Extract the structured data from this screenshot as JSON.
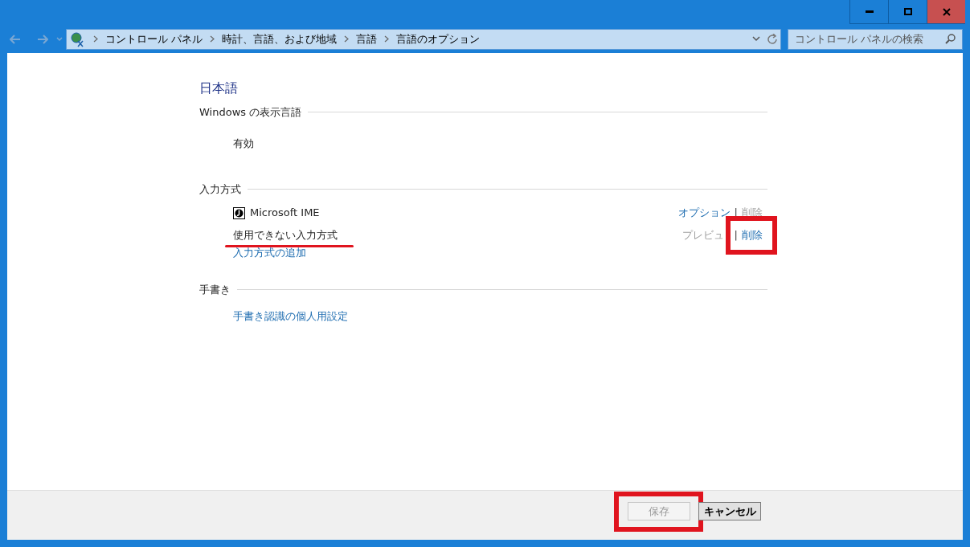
{
  "address_bar": {
    "breadcrumbs": [
      "コントロール パネル",
      "時計、言語、および地域",
      "言語",
      "言語のオプション"
    ]
  },
  "search": {
    "placeholder": "コントロール パネルの検索"
  },
  "language_title": "日本語",
  "sections": [
    {
      "heading": "Windows の表示言語",
      "kind": "status",
      "value": "有効"
    },
    {
      "heading": "入力方式",
      "kind": "methods",
      "methods": [
        {
          "name": "Microsoft IME",
          "icon": true,
          "underlined": false,
          "separator": "|",
          "actions": [
            {
              "label": "オプション",
              "disabled": false
            },
            {
              "label": "削除",
              "disabled": true
            }
          ]
        },
        {
          "name": "使用できない入力方式",
          "icon": false,
          "underlined": true,
          "separator": "|",
          "actions": [
            {
              "label": "プレビュ",
              "disabled": true
            },
            {
              "label": "削除",
              "disabled": false,
              "highlighted": true
            }
          ]
        }
      ],
      "link": "入力方式の追加"
    },
    {
      "heading": "手書き",
      "kind": "links",
      "link": "手書き認識の個人用設定"
    }
  ],
  "buttons": [
    {
      "label": "保存",
      "disabled": true,
      "highlighted": true
    },
    {
      "label": "キャンセル",
      "disabled": false,
      "highlighted": false
    }
  ]
}
